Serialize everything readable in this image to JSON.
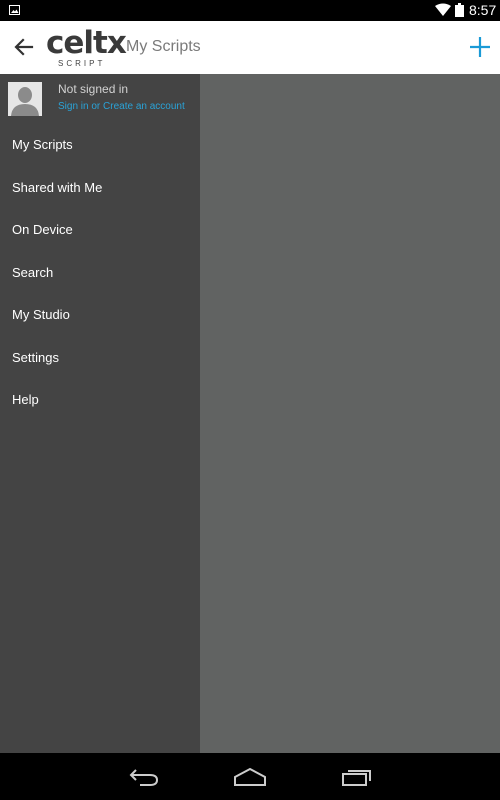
{
  "status_bar": {
    "time": "8:57",
    "icons": [
      "notification-image-icon",
      "wifi-icon",
      "battery-icon"
    ]
  },
  "action_bar": {
    "logo_text": "celtx",
    "logo_subtext": "SCRIPT",
    "title": "My Scripts",
    "accent_color": "#1a9ad6"
  },
  "drawer": {
    "account": {
      "name": "Not signed in",
      "link": "Sign in or Create an account"
    },
    "items": [
      {
        "label": "My Scripts"
      },
      {
        "label": "Shared with Me"
      },
      {
        "label": "On Device"
      },
      {
        "label": "Search"
      },
      {
        "label": "My Studio"
      },
      {
        "label": "Settings"
      },
      {
        "label": "Help"
      }
    ]
  },
  "colors": {
    "drawer_bg": "#444444",
    "content_bg": "#616362",
    "link": "#2aa3d8"
  }
}
